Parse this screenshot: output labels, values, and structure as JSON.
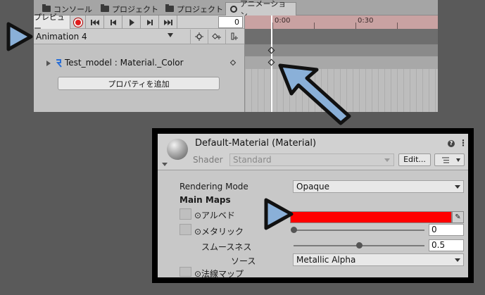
{
  "animation_window": {
    "tabs": [
      {
        "label": "コンソール",
        "icon": "console-icon"
      },
      {
        "label": "プロジェクト",
        "icon": "folder-icon"
      },
      {
        "label": "プロジェクト",
        "icon": "folder-icon"
      },
      {
        "label": "アニメーション",
        "icon": "clock-icon"
      }
    ],
    "preview_label": "プレビュー",
    "frame_value": "0",
    "clip_name": "Animation 4",
    "property_label": "Test_model : Material._Color",
    "add_property_label": "プロパティを追加",
    "timeline_marks": [
      "0:00",
      "0:30"
    ]
  },
  "inspector": {
    "material_title": "Default-Material (Material)",
    "help_label": "?",
    "shader_label": "Shader",
    "shader_value": "Standard",
    "edit_label": "Edit...",
    "rendering_mode_label": "Rendering Mode",
    "rendering_mode_value": "Opaque",
    "main_maps_label": "Main Maps",
    "albedo_label": "⊙アルベド",
    "albedo_color": "#ff0000",
    "metallic_label": "⊙メタリック",
    "metallic_value": "0",
    "smoothness_label": "スムースネス",
    "smoothness_value": "0.5",
    "source_label": "ソース",
    "source_value": "Metallic Alpha",
    "normal_map_label": "⊙法線マップ"
  },
  "colors": {
    "arrow_fill": "#8ab0d8",
    "record": "#e21b1b",
    "albedo": "#ff0000"
  }
}
